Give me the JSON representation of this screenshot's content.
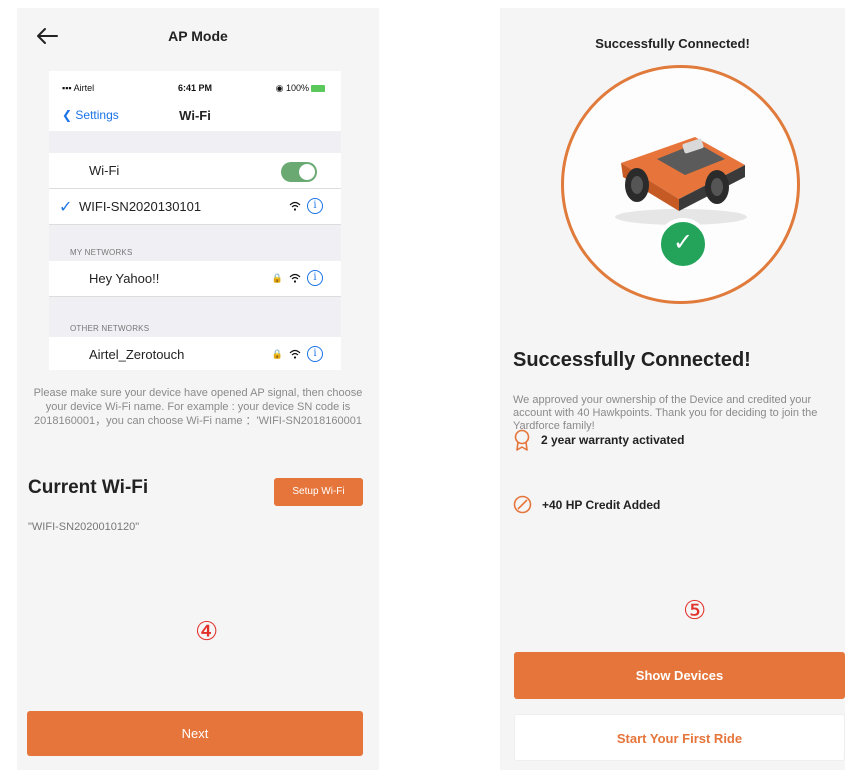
{
  "left": {
    "header_title": "AP Mode",
    "ios": {
      "carrier": "Airtel",
      "time": "6:41 PM",
      "battery": "100%",
      "back_label": "Settings",
      "nav_title": "Wi-Fi",
      "wifi_label": "Wi-Fi",
      "connected_network": "WIFI-SN2020130101",
      "my_networks_label": "MY NETWORKS",
      "my_networks": [
        "Hey Yahoo!!"
      ],
      "other_networks_label": "OTHER NETWORKS",
      "other_networks": [
        "Airtel_Zerotouch"
      ]
    },
    "help_text": "Please make sure your device have opened AP signal, then choose your device Wi-Fi name. For example : your device SN code is 2018160001，you can choose Wi-Fi name ：'WIFI-SN2018160001",
    "current_wifi_title": "Current Wi-Fi",
    "setup_button": "Setup Wi-Fi",
    "current_wifi_value": "\"WIFI-SN2020010120\"",
    "step_marker": "④",
    "next_button": "Next"
  },
  "right": {
    "title": "Successfully Connected!",
    "heading": "Successfully Connected!",
    "description": "We approved your ownership of the Device and credited your account with 40 Hawkpoints. Thank you for deciding to join the Yardforce family!",
    "features": [
      {
        "icon": "award-icon",
        "label": "2 year warranty activated"
      },
      {
        "icon": "credit-slash-icon",
        "label": "+40 HP Credit Added"
      }
    ],
    "step_marker": "⑤",
    "show_devices_button": "Show Devices",
    "first_ride_button": "Start Your First Ride"
  },
  "colors": {
    "accent": "#e5753a",
    "success": "#23a45a",
    "ios_blue": "#1a73e8",
    "step_red": "#e2312a"
  }
}
